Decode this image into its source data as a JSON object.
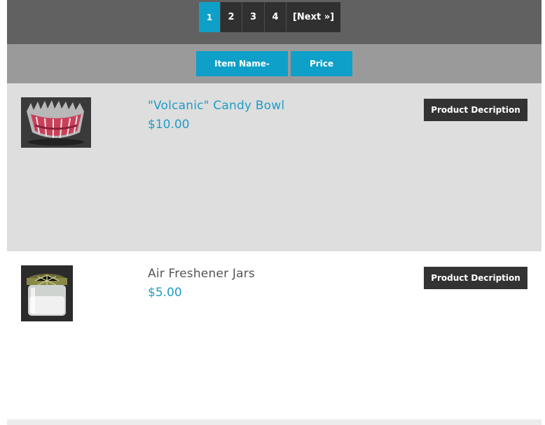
{
  "pagination": {
    "pages": [
      "1",
      "2",
      "3",
      "4"
    ],
    "active_page": "1",
    "next_label": "[Next »]"
  },
  "sort": {
    "item_name_label": "Item Name-",
    "price_label": "Price"
  },
  "products": [
    {
      "name": "\"Volcanic\" Candy Bowl",
      "price": "$10.00",
      "description_button": "Product Decription",
      "image_icon": "candy-bowl-image"
    },
    {
      "name": "Air Freshener Jars",
      "price": "$5.00",
      "description_button": "Product Decription",
      "image_icon": "jar-image"
    }
  ],
  "colors": {
    "accent": "#0ea0c8",
    "pager_bg": "#616161",
    "sort_bar_bg": "#9a9a9a",
    "dark_button": "#333333",
    "row_alt_bg": "#dedede"
  }
}
